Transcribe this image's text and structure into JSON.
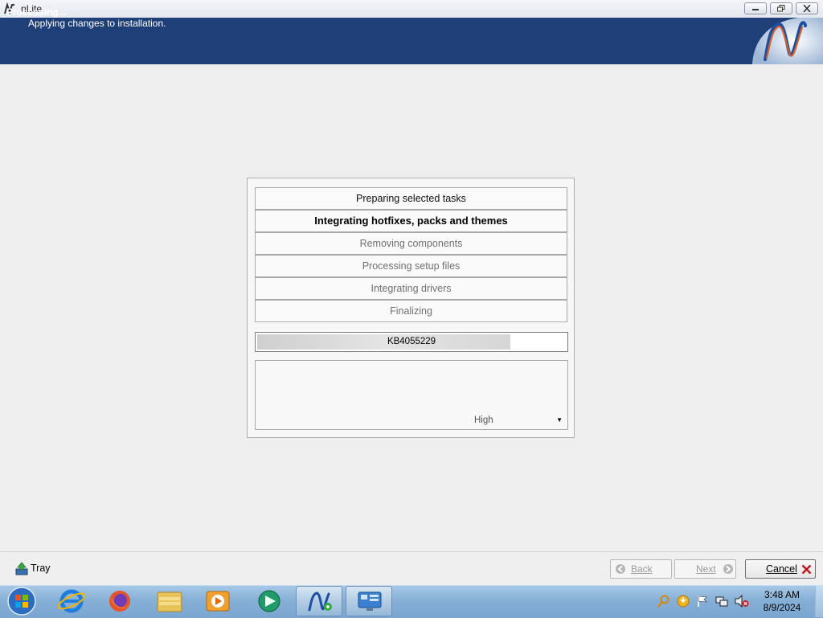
{
  "window": {
    "title": "nLite"
  },
  "header": {
    "title": "Processing...",
    "subtitle": "Applying changes to installation."
  },
  "steps": [
    {
      "label": "Preparing selected tasks",
      "state": "done"
    },
    {
      "label": "Integrating hotfixes, packs and themes",
      "state": "active"
    },
    {
      "label": "Removing components",
      "state": "pending"
    },
    {
      "label": "Processing setup files",
      "state": "pending"
    },
    {
      "label": "Integrating drivers",
      "state": "pending"
    },
    {
      "label": "Finalizing",
      "state": "pending"
    }
  ],
  "progress": {
    "text": "KB4055229",
    "fraction": 0.82
  },
  "priority": {
    "selected": "High"
  },
  "bottom": {
    "tray_label": "Tray",
    "back_label": "Back",
    "next_label": "Next",
    "cancel_label": "Cancel"
  },
  "taskbar": {
    "items": [
      "start-orb-icon",
      "internet-explorer-icon",
      "firefox-icon",
      "file-explorer-icon",
      "media-player-icon",
      "media-center-icon",
      "nlite-icon",
      "remote-desktop-icon"
    ],
    "clock_time": "3:48 AM",
    "clock_date": "8/9/2024"
  },
  "colors": {
    "header_bg": "#1f3f78",
    "taskbar": "#86afd6"
  }
}
